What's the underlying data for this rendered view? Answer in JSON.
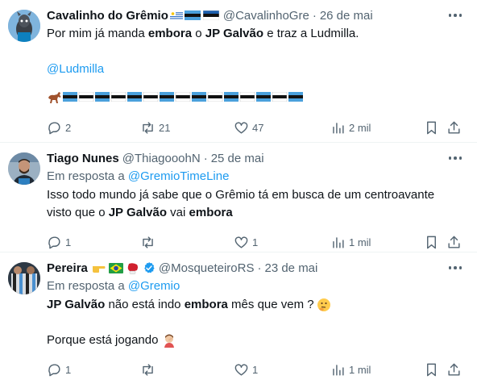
{
  "tweets": [
    {
      "name": "Cavalinho do Grêmio",
      "handle": "@CavalinhoGre",
      "dot": "·",
      "date": "26 de mai",
      "text_parts": [
        "Por mim já manda ",
        "embora",
        " o ",
        "JP Galvão",
        " e traz a Ludmilla."
      ],
      "mention": "@Ludmilla",
      "emoji_row": "horse + Grêmio flags",
      "replies": "2",
      "retweets": "21",
      "likes": "47",
      "views": "2 mil"
    },
    {
      "name": "Tiago Nunes",
      "handle": "@ThiagooohN",
      "dot": "·",
      "date": "25 de mai",
      "reply_prefix": "Em resposta a ",
      "reply_to": "@GremioTimeLine",
      "text_line1": "Isso todo mundo já sabe que o Grêmio tá em busca de um centroavante",
      "text_parts2": [
        "visto que o ",
        "JP Galvão",
        " vai ",
        "embora"
      ],
      "replies": "1",
      "retweets": "",
      "likes": "1",
      "views": "1 mil"
    },
    {
      "name": "Pereira",
      "handle": "@MosqueteiroRS",
      "dot": "·",
      "date": "23 de mai",
      "reply_prefix": "Em resposta a ",
      "reply_to": "@Gremio",
      "text_parts": [
        "JP Galvão",
        " não está indo ",
        "embora",
        " mês que vem ?"
      ],
      "text_line2": "Porque está jogando",
      "replies": "1",
      "retweets": "",
      "likes": "1",
      "views": "1 mil"
    }
  ],
  "colors": {
    "link": "#1d9bf0",
    "muted": "#536471",
    "verified": "#1d9bf0",
    "gremio_blue": "#0d80bf"
  },
  "icons": [
    "reply-icon",
    "retweet-icon",
    "like-icon",
    "views-icon",
    "bookmark-icon",
    "share-icon",
    "more-icon",
    "verified-icon"
  ]
}
